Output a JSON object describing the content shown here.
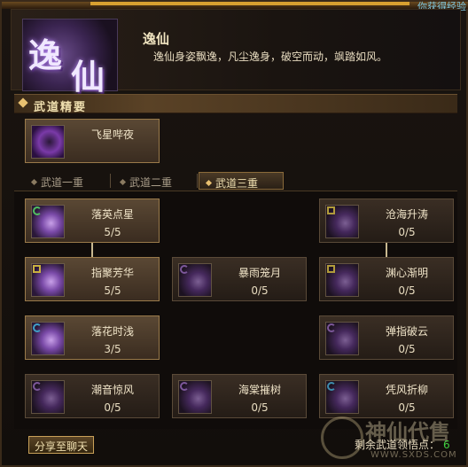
{
  "top_hint": "你获得经验",
  "header": {
    "emblem_char1": "逸",
    "emblem_char2": "仙",
    "title": "逸仙",
    "description": "逸仙身姿飘逸，凡尘逸身，破空而动，飒踏如风。"
  },
  "essence": {
    "section_label": "武道精要",
    "skill_name": "飞星哔夜"
  },
  "tabs": [
    {
      "label": "武道一重",
      "active": false
    },
    {
      "label": "武道二重",
      "active": false
    },
    {
      "label": "武道三重",
      "active": true
    }
  ],
  "nodes": {
    "n1": {
      "name": "落英点星",
      "level": "5/5",
      "lit": true,
      "icon": "green-swirl-icon"
    },
    "n2": {
      "name": "指聚芳华",
      "level": "5/5",
      "lit": true,
      "icon": "yellow-glyph-icon"
    },
    "n3": {
      "name": "落花时浅",
      "level": "3/5",
      "lit": true,
      "icon": "blue-crescent-icon"
    },
    "n4": {
      "name": "潮音惊风",
      "level": "0/5",
      "lit": false,
      "icon": "purple-swirl-icon"
    },
    "n5": {
      "name": "暴雨笼月",
      "level": "0/5",
      "lit": false,
      "icon": "purple-swirl-icon"
    },
    "n6": {
      "name": "海棠摧树",
      "level": "0/5",
      "lit": false,
      "icon": "purple-swirl-icon"
    },
    "n7": {
      "name": "沧海升涛",
      "level": "0/5",
      "lit": false,
      "icon": "yellow-glyph-icon"
    },
    "n8": {
      "name": "渊心渐明",
      "level": "0/5",
      "lit": false,
      "icon": "yellow-glyph-icon"
    },
    "n9": {
      "name": "弹指破云",
      "level": "0/5",
      "lit": false,
      "icon": "purple-swirl-icon"
    },
    "n10": {
      "name": "凭风折柳",
      "level": "0/5",
      "lit": false,
      "icon": "blue-crescent-icon"
    }
  },
  "footer": {
    "share_label": "分享至聊天",
    "remain_label": "剩余武道领悟点：",
    "remain_value": "6"
  },
  "watermark": {
    "text": "神仙代售",
    "url": "WWW.SXDS.COM"
  },
  "colors": {
    "accent_gold": "#d8a030",
    "points_green": "#40d040"
  }
}
